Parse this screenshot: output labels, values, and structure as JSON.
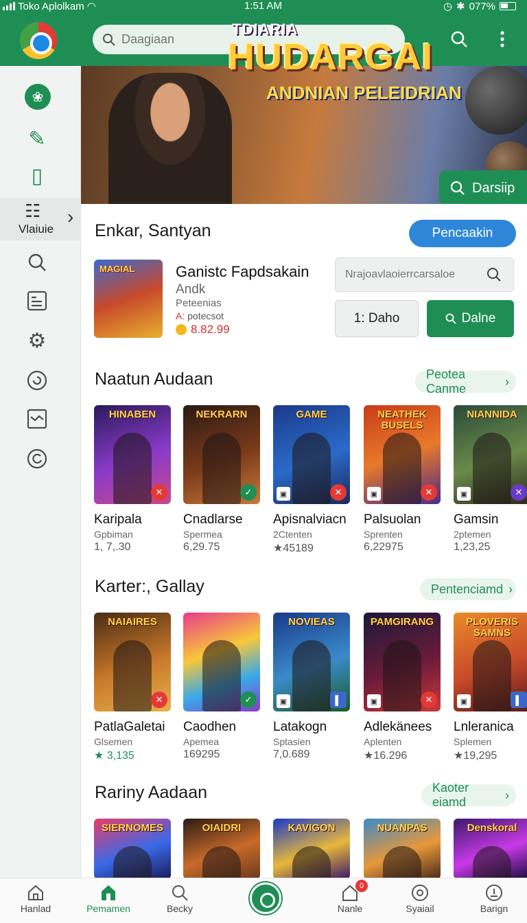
{
  "status_bar": {
    "carrier": "Toko Aplolkam",
    "time": "1:51 AM",
    "battery": "077%"
  },
  "header": {
    "search_placeholder": "Daagiaan"
  },
  "sidebar": {
    "active_label": "Vlaiuie"
  },
  "hero": {
    "pretitle": "TDIARIA",
    "title": "HUDARGAI",
    "subtitle": "ANDNIAN PELEIDRIAN",
    "button_label": "Darsiip"
  },
  "featured": {
    "section_title": "Enkar, Santyan",
    "action_label": "Pencaakin",
    "thumb_text": "MAGIAL",
    "name": "Ganistc Fapdsakain",
    "developer": "Andk",
    "category": "Peteenias",
    "meta_prefix": "A:",
    "meta": "potecsot",
    "price": "8.82.99",
    "search_placeholder": "Nrajoavlaoierrcarsaloe",
    "button_secondary": "1: Daho",
    "button_primary": "Dalne"
  },
  "sections": [
    {
      "title": "Naatun Audaan",
      "link": "Peotea Canme",
      "cards": [
        {
          "art_text": "HINABEN",
          "name": "Karipala",
          "sub": "Gpbiman",
          "num": "1, 7,.30",
          "bg": "linear-gradient(160deg,#2a1a5a,#8a3ac8 55%,#c84a8a)"
        },
        {
          "art_text": "NEKRARN",
          "name": "Cnadlarse",
          "sub": "Spermea",
          "num": "6,29.75",
          "bg": "linear-gradient(160deg,#2a1a14,#7a3a1a 55%,#c87a3a)"
        },
        {
          "art_text": "GAME",
          "name": "Apisnalviacn",
          "sub": "2Ctenten",
          "num": "★45189",
          "bg": "linear-gradient(160deg,#1a3a8a,#2a6ac8 55%,#1a2a5a)"
        },
        {
          "art_text": "NEATHEK BUSELS",
          "name": "Palsuolan",
          "sub": "Sprenten",
          "num": "6,22975",
          "bg": "linear-gradient(160deg,#c83a1a,#e87a2a 50%,#4a2a8a)"
        },
        {
          "art_text": "NIANNIDA",
          "name": "Gamsin",
          "sub": "2ptemen",
          "num": "1,23,25",
          "bg": "linear-gradient(160deg,#2a4a3a,#6a8a4a 55%,#2a2a1a)"
        }
      ]
    },
    {
      "title": "Karter:, Gallay",
      "link": "Pentenciamd",
      "cards": [
        {
          "art_text": "NAIAIRES",
          "name": "PatlaGaletai",
          "sub": "Glsemen",
          "num": "★ 3,135",
          "bg": "linear-gradient(160deg,#4a2a14,#c8782a 55%,#e8b04a)",
          "num_green": true
        },
        {
          "art_text": "",
          "name": "Caodhen",
          "sub": "Apemea",
          "num": "169295",
          "bg": "linear-gradient(160deg,#e83a8a,#f8c83a 40%,#3aa8e8 70%,#8a3ac8)"
        },
        {
          "art_text": "NOVIEAS",
          "name": "Latakogn",
          "sub": "Sptasien",
          "num": "7,0.689",
          "bg": "linear-gradient(160deg,#1a3a8a,#3a8ac8 55%,#1a5a2a)"
        },
        {
          "art_text": "PAMGIRANG",
          "name": "Adlekänees",
          "sub": "Aplenten",
          "num": "★16.296",
          "bg": "linear-gradient(160deg,#1a1a3a,#6a1a3a 55%,#c83a3a)"
        },
        {
          "art_text": "PLOVERIS SAMNS",
          "name": "Lnleranica",
          "sub": "Splemen",
          "num": "★19,295",
          "bg": "linear-gradient(160deg,#e88a2a,#c84a2a 55%,#5a1a1a)"
        }
      ]
    },
    {
      "title": "Rariny Aadaan",
      "link": "Kaoter eiamd",
      "cards": [
        {
          "art_text": "SIERNOMES",
          "bg": "linear-gradient(160deg,#e83a6a,#3a6ae8 55%,#1a1a5a)"
        },
        {
          "art_text": "OIAIDRI",
          "bg": "linear-gradient(160deg,#2a1a14,#c86a2a 55%,#6a3a1a)"
        },
        {
          "art_text": "KAVIGON",
          "bg": "linear-gradient(160deg,#1a3ac8,#e8b83a 55%,#3a1a6a)"
        },
        {
          "art_text": "NUANPAS",
          "bg": "linear-gradient(160deg,#3a8ac8,#e8983a 55%,#4a2a1a)"
        },
        {
          "art_text": "Denskoral",
          "bg": "linear-gradient(160deg,#3a1a6a,#c83ae8 55%,#1a0a3a)"
        }
      ]
    }
  ],
  "bottom_nav": [
    {
      "label": "Hanlad",
      "icon": "home-icon"
    },
    {
      "label": "Pemamen",
      "icon": "store-icon"
    },
    {
      "label": "Becky",
      "icon": "search-icon"
    },
    {
      "label": "Nanle",
      "icon": "shop-icon",
      "badge": "0"
    },
    {
      "label": "Syaiail",
      "icon": "compass-icon"
    },
    {
      "label": "Barign",
      "icon": "account-icon"
    }
  ],
  "colors": {
    "primary": "#1f8e55",
    "accent_blue": "#2e86d8",
    "price_red": "#d32f2f"
  }
}
